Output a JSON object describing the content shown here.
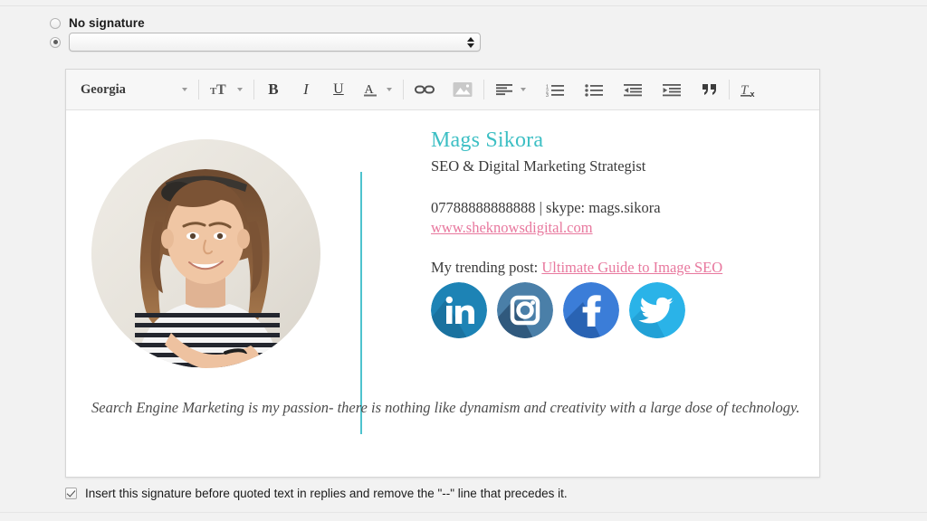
{
  "options": {
    "no_signature": {
      "label": "No signature",
      "selected": false,
      "icon": "radio-unselected-icon"
    },
    "signature_select": {
      "selected": true,
      "value": "",
      "placeholder": "",
      "icon": "radio-selected-icon",
      "stepper_icon": "updown-arrows-icon"
    }
  },
  "toolbar": {
    "font_family": "Georgia",
    "buttons": [
      {
        "name": "font-family-dropdown",
        "label": "Georgia",
        "icon": "chevron-down-icon"
      },
      {
        "name": "font-size-button",
        "label": "",
        "icon": "text-size-icon"
      },
      {
        "name": "bold-button",
        "label": "B",
        "icon": "bold-icon"
      },
      {
        "name": "italic-button",
        "label": "I",
        "icon": "italic-icon"
      },
      {
        "name": "underline-button",
        "label": "U",
        "icon": "underline-icon"
      },
      {
        "name": "text-color-button",
        "label": "A",
        "icon": "text-color-icon"
      },
      {
        "name": "insert-link-button",
        "label": "",
        "icon": "link-icon"
      },
      {
        "name": "insert-image-button",
        "label": "",
        "icon": "image-icon"
      },
      {
        "name": "align-button",
        "label": "",
        "icon": "align-left-icon"
      },
      {
        "name": "numbered-list-button",
        "label": "",
        "icon": "numbered-list-icon"
      },
      {
        "name": "bulleted-list-button",
        "label": "",
        "icon": "bulleted-list-icon"
      },
      {
        "name": "decrease-indent-button",
        "label": "",
        "icon": "indent-decrease-icon"
      },
      {
        "name": "increase-indent-button",
        "label": "",
        "icon": "indent-increase-icon"
      },
      {
        "name": "blockquote-button",
        "label": "",
        "icon": "quote-icon"
      },
      {
        "name": "remove-formatting-button",
        "label": "",
        "icon": "remove-formatting-icon"
      }
    ]
  },
  "signature": {
    "photo_alt": "profile-photo",
    "name": "Mags Sikora",
    "title": "SEO & Digital Marketing Strategist",
    "contact": "07788888888888 | skype: mags.sikora",
    "website": "www.sheknowsdigital.com",
    "trending_prefix": "My trending post: ",
    "trending_link": "Ultimate Guide to Image SEO",
    "quote": "Search Engine Marketing is my passion- there is nothing like dynamism and creativity with a large dose of technology.",
    "socials": [
      {
        "name": "linkedin-icon",
        "label": "LinkedIn",
        "color": "#1d83b5",
        "shadow": "#17658c"
      },
      {
        "name": "instagram-icon",
        "label": "Instagram",
        "color": "#4a7fa8",
        "shadow": "#1f3f60"
      },
      {
        "name": "facebook-icon",
        "label": "Facebook",
        "color": "#3b7dd8",
        "shadow": "#1c4f95"
      },
      {
        "name": "twitter-icon",
        "label": "Twitter",
        "color": "#2ab3e8",
        "shadow": "#1a8fc4"
      }
    ]
  },
  "footer": {
    "checkbox_checked": true,
    "checkbox_icon": "checkmark-icon",
    "label": "Insert this signature before quoted text in replies and remove the \"--\" line that precedes it."
  },
  "colors": {
    "name_accent": "#3dbfc4",
    "link_pink": "#e8789e",
    "divider_teal": "#4ec3ce",
    "page_bg": "#f2f2f2",
    "editor_bg": "#ffffff"
  }
}
